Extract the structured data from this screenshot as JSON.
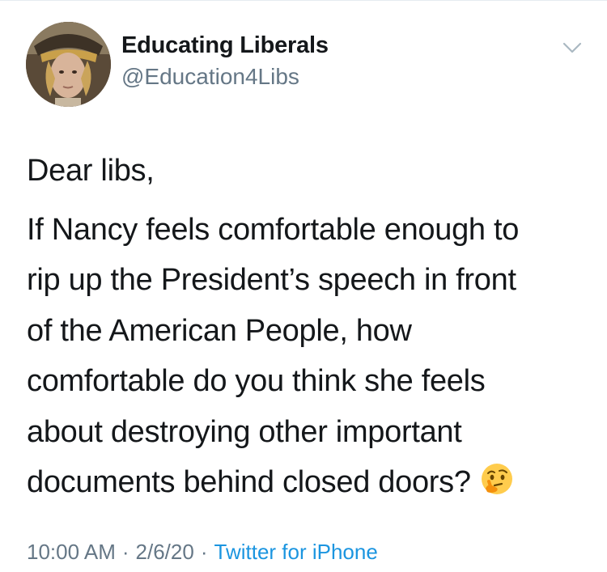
{
  "author": {
    "name": "Educating Liberals",
    "handle": "@Education4Libs"
  },
  "tweet": {
    "greeting": "Dear libs,",
    "lines": [
      "If Nancy feels comfortable enough to",
      "rip up the President’s speech in front",
      "of the American People, how",
      "comfortable do you think she feels",
      "about destroying other important",
      "documents behind closed doors?"
    ],
    "emoji": "thinking-face"
  },
  "meta": {
    "time": "10:00 AM",
    "separator": "·",
    "date": "2/6/20",
    "source": "Twitter for iPhone"
  },
  "colors": {
    "text": "#14171a",
    "secondary": "#657786",
    "link": "#1b95e0",
    "divider": "#e6ecf0"
  },
  "icons": {
    "menu": "chevron-down-icon",
    "avatar": "profile-photo"
  }
}
